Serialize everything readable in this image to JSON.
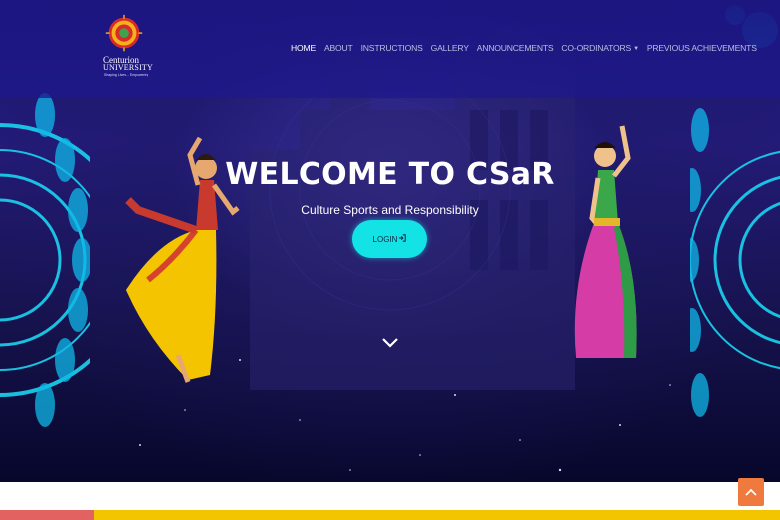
{
  "brand": {
    "name_line1": "Centurion",
    "name_line2": "UNIVERSITY",
    "tagline": "Shaping Lives... Empowering Communities..."
  },
  "nav": {
    "items": [
      {
        "label": "HOME",
        "active": true
      },
      {
        "label": "ABOUT"
      },
      {
        "label": "INSTRUCTIONS"
      },
      {
        "label": "GALLERY"
      },
      {
        "label": "ANNOUNCEMENTS"
      },
      {
        "label": "CO-ORDINATORS",
        "dropdown": true
      },
      {
        "label": "PREVIOUS ACHIEVEMENTS"
      }
    ]
  },
  "hero": {
    "title": "WELCOME TO CSaR",
    "subtitle": "Culture Sports and Responsibility",
    "login_label": "LOGIN"
  },
  "icons": {
    "login": "sign-in-icon",
    "scroll": "chevron-down-icon",
    "back_to_top": "chevron-up-icon"
  },
  "colors": {
    "accent": "#14e3e6",
    "nav_bg": "#1e188c",
    "footer_gold": "#f2c500",
    "footer_red": "#e26262",
    "top_button": "#f0793d"
  }
}
